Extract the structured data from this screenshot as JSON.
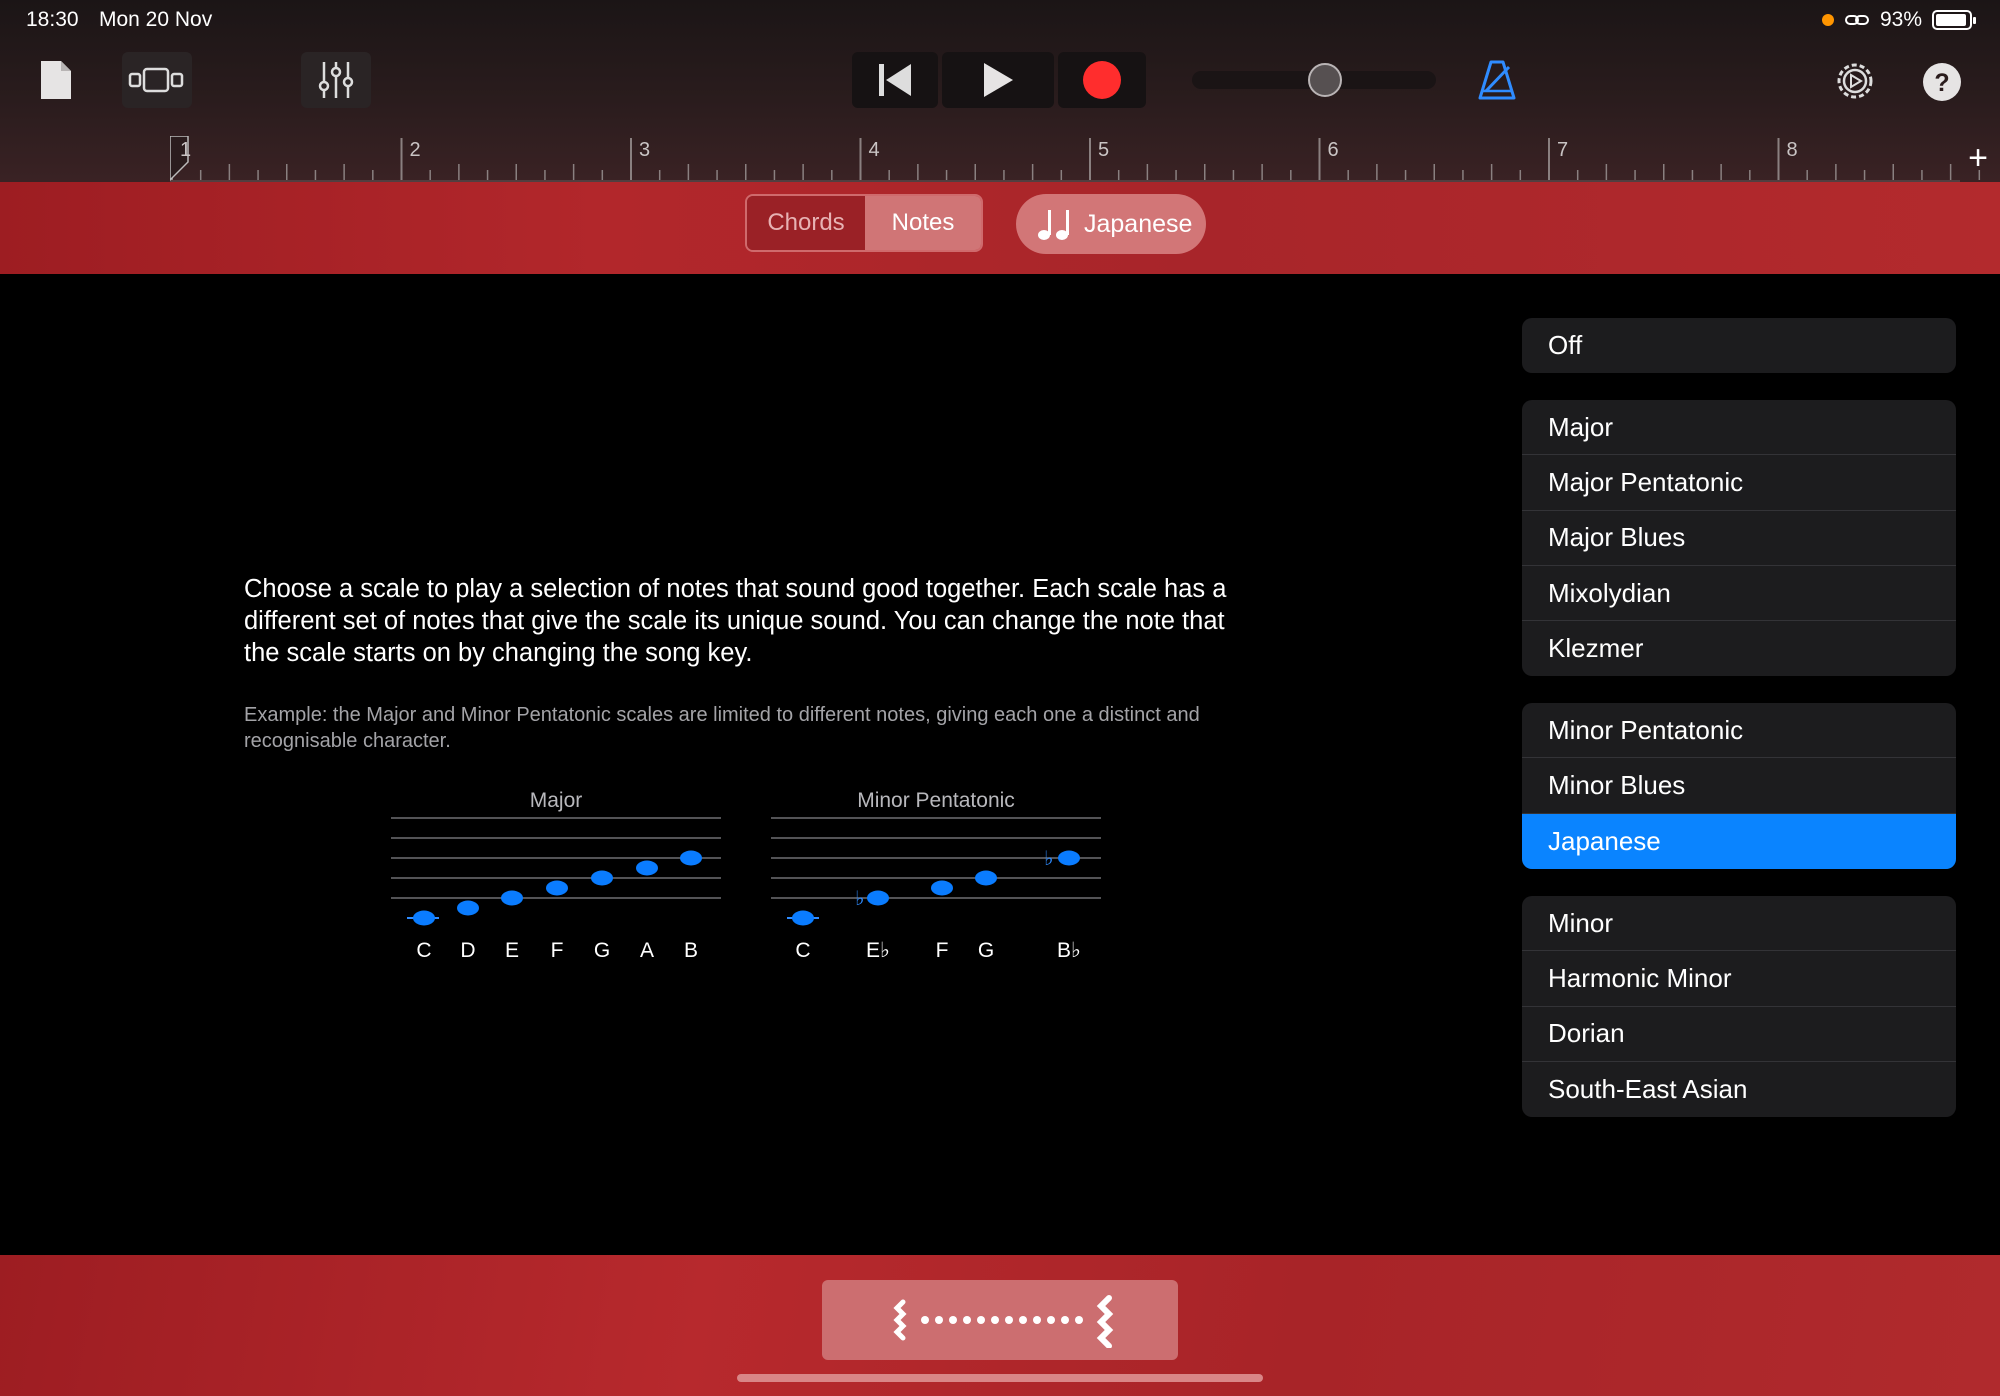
{
  "status_bar": {
    "time": "18:30",
    "date": "Mon 20 Nov",
    "battery": "93%",
    "battery_level": 0.93
  },
  "toolbar": {
    "icons": [
      "document-icon",
      "tracks-view-icon",
      "mixer-icon",
      "rewind-icon",
      "play-icon",
      "record-icon",
      "volume-slider",
      "metronome-icon",
      "settings-icon",
      "help-icon"
    ],
    "record_color": "#ff2d2d",
    "volume_level": 0.57
  },
  "ruler": {
    "bars": [
      "1",
      "2",
      "3",
      "4",
      "5",
      "6",
      "7",
      "8"
    ],
    "add_label": "+"
  },
  "mode_switch": {
    "chords_label": "Chords",
    "notes_label": "Notes",
    "selected": "Notes"
  },
  "scale_button": {
    "label": "Japanese"
  },
  "content": {
    "description": "Choose a scale to play a selection of notes that sound good together. Each scale has a different set of notes that give the scale its unique sound. You can change the note that the scale starts on by changing the song key.",
    "example": "Example: the Major and Minor Pentatonic scales are limited to different notes, giving each one a distinct and recognisable character.",
    "staves": [
      {
        "title": "Major",
        "notes": [
          "C",
          "D",
          "E",
          "F",
          "G",
          "A",
          "B"
        ]
      },
      {
        "title": "Minor Pentatonic",
        "notes": [
          "C",
          "E♭",
          "F",
          "G",
          "B♭"
        ]
      }
    ]
  },
  "scale_list": {
    "groups": [
      {
        "items": [
          "Off"
        ]
      },
      {
        "items": [
          "Major",
          "Major Pentatonic",
          "Major Blues",
          "Mixolydian",
          "Klezmer"
        ]
      },
      {
        "items": [
          "Minor Pentatonic",
          "Minor Blues",
          "Japanese"
        ]
      },
      {
        "items": [
          "Minor",
          "Harmonic Minor",
          "Dorian",
          "South-East Asian"
        ]
      }
    ],
    "selected": "Japanese",
    "accent_color": "#0a84ff"
  }
}
